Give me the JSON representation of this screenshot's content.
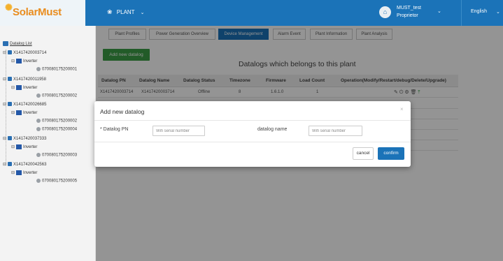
{
  "header": {
    "logo": "SolarMust",
    "plant_menu": "PLANT",
    "user_name": "MUST_test",
    "user_role": "Proprietor",
    "language": "English"
  },
  "sidebar": {
    "title": "Datalog List",
    "tree": [
      {
        "sn": "X1417420003714",
        "inverter": "Inverter",
        "device": "070080175200001"
      },
      {
        "sn": "X1417420011958",
        "inverter": "Inverter",
        "device": "070080175200002"
      },
      {
        "sn": "X1417420026685",
        "inverter": "Inverter",
        "devices": [
          "070080175200002",
          "070080175200004"
        ]
      },
      {
        "sn": "X1417420037333",
        "inverter": "Inverter",
        "device": "070080175200003"
      },
      {
        "sn": "X1417420042563",
        "inverter": "Inverter",
        "device": "070080175200005"
      }
    ]
  },
  "tabs": [
    "Plant Profiles",
    "Power Generation Overview",
    "Device Management",
    "Alarm Event",
    "Plant Information",
    "Plant Analysis"
  ],
  "active_tab": "Device Management",
  "main": {
    "add_button": "Add new datalog",
    "title": "Datalogs which belongs to this plant",
    "columns": [
      "Datalog PN",
      "Datalog Name",
      "Datalog Status",
      "Timezone",
      "Firmware",
      "Load Count",
      "Operation(Modify/Restart/debug/Delete/Upgrade)"
    ],
    "rows": [
      {
        "pn": "X1417420003714",
        "name": "X1417420003714",
        "status": "Offline",
        "timezone": "8",
        "firmware": "1.6.1.0",
        "load": "1"
      }
    ]
  },
  "modal": {
    "title": "Add new datalog",
    "close": "×",
    "pn_label": "* Datalog PN",
    "pn_placeholder": "Wifi serial number",
    "name_label": "datalog name",
    "name_placeholder": "Wifi serial number",
    "cancel": "cancel",
    "confirm": "confirm"
  },
  "colors": {
    "brand_blue": "#1b73b8",
    "green": "#3c9d46",
    "logo_orange": "#e98d1f"
  },
  "icons": [
    "leaf-icon",
    "user-icon",
    "chevron-down-icon",
    "datalog-icon",
    "inverter-icon",
    "device-icon",
    "edit-icon",
    "restart-icon",
    "debug-icon",
    "delete-icon",
    "upgrade-icon",
    "close-icon"
  ]
}
